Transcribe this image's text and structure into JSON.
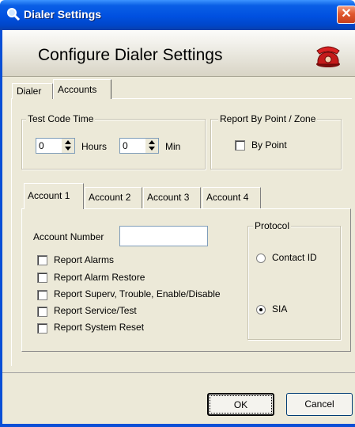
{
  "window": {
    "title": "Dialer Settings"
  },
  "banner": {
    "heading": "Configure Dialer Settings"
  },
  "top_tabs": [
    {
      "label": "Dialer"
    },
    {
      "label": "Accounts"
    }
  ],
  "test_code_time": {
    "title": "Test Code Time",
    "hours_value": "0",
    "hours_label": "Hours",
    "min_value": "0",
    "min_label": "Min"
  },
  "report_by_point": {
    "title": "Report By Point / Zone",
    "checkbox_label": "By Point",
    "checked": false
  },
  "account_tabs": [
    {
      "label": "Account 1"
    },
    {
      "label": "Account 2"
    },
    {
      "label": "Account 3"
    },
    {
      "label": "Account 4"
    }
  ],
  "account": {
    "number_label": "Account Number",
    "number_value": "",
    "options": [
      {
        "label": "Report Alarms",
        "checked": false
      },
      {
        "label": "Report Alarm Restore",
        "checked": false
      },
      {
        "label": "Report Superv, Trouble, Enable/Disable",
        "checked": false
      },
      {
        "label": "Report Service/Test",
        "checked": false
      },
      {
        "label": "Report System Reset",
        "checked": false
      }
    ]
  },
  "protocol": {
    "title": "Protocol",
    "options": [
      {
        "label": "Contact ID",
        "selected": false
      },
      {
        "label": "SIA",
        "selected": true
      }
    ]
  },
  "buttons": {
    "ok": "OK",
    "cancel": "Cancel"
  },
  "colors": {
    "title_bar": "#0050e0",
    "close_button": "#e0582f",
    "dialog_bg": "#ece9d8"
  },
  "icons": {
    "title": "magnifier-icon",
    "banner": "red-telephone-icon",
    "close": "close-icon"
  }
}
